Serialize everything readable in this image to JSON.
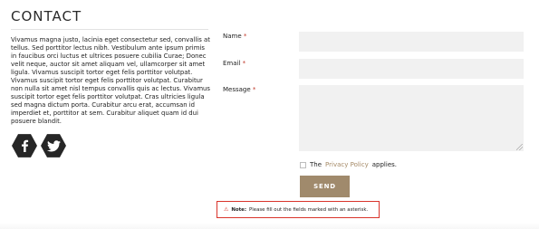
{
  "section": {
    "title": "CONTACT",
    "body": "Vivamus magna justo, lacinia eget consectetur sed, convallis at tellus. Sed porttitor lectus nibh. Vestibulum ante ipsum primis in faucibus orci luctus et ultrices posuere cubilia Curae; Donec velit neque, auctor sit amet aliquam vel, ullamcorper sit amet ligula. Vivamus suscipit tortor eget felis porttitor volutpat. Vivamus suscipit tortor eget felis porttitor volutpat. Curabitur non nulla sit amet nisl tempus convallis quis ac lectus. Vivamus suscipit tortor eget felis porttitor volutpat. Cras ultricies ligula sed magna dictum porta. Curabitur arcu erat, accumsan id imperdiet et, porttitor at sem. Curabitur aliquet quam id dui posuere blandit."
  },
  "social": {
    "facebook_icon": "facebook-icon",
    "twitter_icon": "twitter-icon"
  },
  "form": {
    "name_label": "Name",
    "email_label": "Email",
    "message_label": "Message",
    "required_mark": "*",
    "name_value": "",
    "email_value": "",
    "message_value": "",
    "privacy_prefix": "The",
    "privacy_link": "Privacy Policy",
    "privacy_suffix": "applies.",
    "send_label": "SEND"
  },
  "note": {
    "icon": "warning-icon",
    "strong": "Note:",
    "text": "Please fill out the fields marked with an asterisk."
  },
  "colors": {
    "accent": "#a08a6c",
    "link": "#a68b68",
    "required": "#c0392b",
    "note_border": "#d9342b",
    "field_bg": "#f1f1f1",
    "icon_bg": "#262626"
  }
}
